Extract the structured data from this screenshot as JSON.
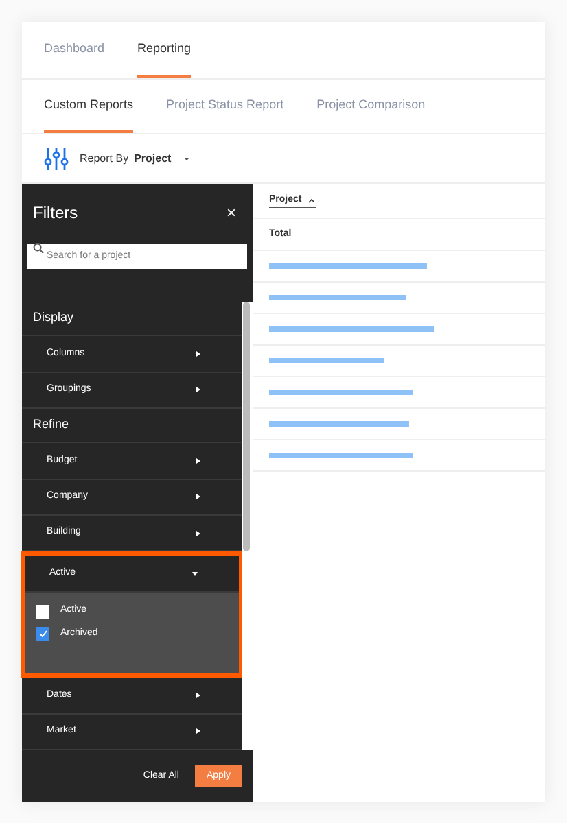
{
  "tabs": [
    {
      "label": "Dashboard",
      "selected": false
    },
    {
      "label": "Reporting",
      "selected": true
    }
  ],
  "subtabs": [
    {
      "label": "Custom Reports",
      "selected": true
    },
    {
      "label": "Project Status Report",
      "selected": false
    },
    {
      "label": "Project Comparison",
      "selected": false
    }
  ],
  "report_by": {
    "label": "Report By",
    "value": "Project"
  },
  "filters": {
    "title": "Filters",
    "close": "×",
    "search": {
      "placeholder": "Search for a project"
    },
    "sections": [
      {
        "title": "Display",
        "items": [
          {
            "label": "Columns",
            "expanded": false
          },
          {
            "label": "Groupings",
            "expanded": false
          }
        ]
      },
      {
        "title": "Refine",
        "items": [
          {
            "label": "Budget",
            "expanded": false
          },
          {
            "label": "Company",
            "expanded": false
          },
          {
            "label": "Building",
            "expanded": false
          },
          {
            "label": "Active",
            "expanded": true,
            "highlighted": true,
            "options": [
              {
                "label": "Active",
                "checked": false
              },
              {
                "label": "Archived",
                "checked": true
              }
            ]
          },
          {
            "label": "Dates",
            "expanded": false
          },
          {
            "label": "Market",
            "expanded": false
          }
        ]
      }
    ],
    "clear": "Clear All",
    "apply": "Apply"
  },
  "table": {
    "column": "Project",
    "total": "Total",
    "rows": [
      {
        "kind": "placeholder"
      },
      {
        "kind": "placeholder"
      },
      {
        "kind": "placeholder"
      },
      {
        "kind": "placeholder"
      },
      {
        "kind": "placeholder"
      },
      {
        "kind": "placeholder"
      },
      {
        "kind": "placeholder"
      }
    ]
  }
}
